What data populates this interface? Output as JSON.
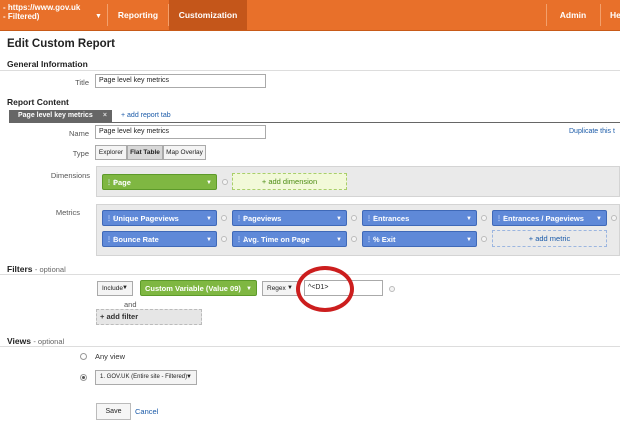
{
  "topnav": {
    "account_line1": "- https://www.gov.uk",
    "account_line2": "- Filtered)",
    "items": [
      "Reporting",
      "Customization",
      "Admin",
      "He"
    ]
  },
  "page_title": "Edit Custom Report",
  "general": {
    "heading": "General Information",
    "title_label": "Title",
    "title_value": "Page level key metrics"
  },
  "report_content": {
    "heading": "Report Content",
    "tab_label": "Page level key metrics",
    "tab_close": "×",
    "add_tab": "+ add report tab",
    "name_label": "Name",
    "name_value": "Page level key metrics",
    "duplicate": "Duplicate this t",
    "type_label": "Type",
    "type_options": [
      "Explorer",
      "Flat Table",
      "Map Overlay"
    ],
    "type_selected": "Flat Table",
    "dimensions_label": "Dimensions",
    "dimension": "Page",
    "add_dimension": "+ add dimension",
    "metrics_label": "Metrics",
    "metrics": [
      "Unique Pageviews",
      "Pageviews",
      "Entrances",
      "Entrances / Pageviews",
      "Bounce Rate",
      "Avg. Time on Page",
      "% Exit"
    ],
    "add_metric": "+ add metric"
  },
  "filters": {
    "heading": "Filters",
    "optional": "- optional",
    "include": "Include",
    "variable": "Custom Variable (Value 09)",
    "match": "Regex",
    "value": "^<D1>",
    "and": "and",
    "add_filter": "+ add filter"
  },
  "views": {
    "heading": "Views",
    "optional": "- optional",
    "any_view": "Any view",
    "selected_view": "1. GOV.UK (Entire site - Filtered)"
  },
  "actions": {
    "save": "Save",
    "cancel": "Cancel"
  },
  "icons": {
    "chevron": "▼",
    "grip": "⋮⋮"
  }
}
